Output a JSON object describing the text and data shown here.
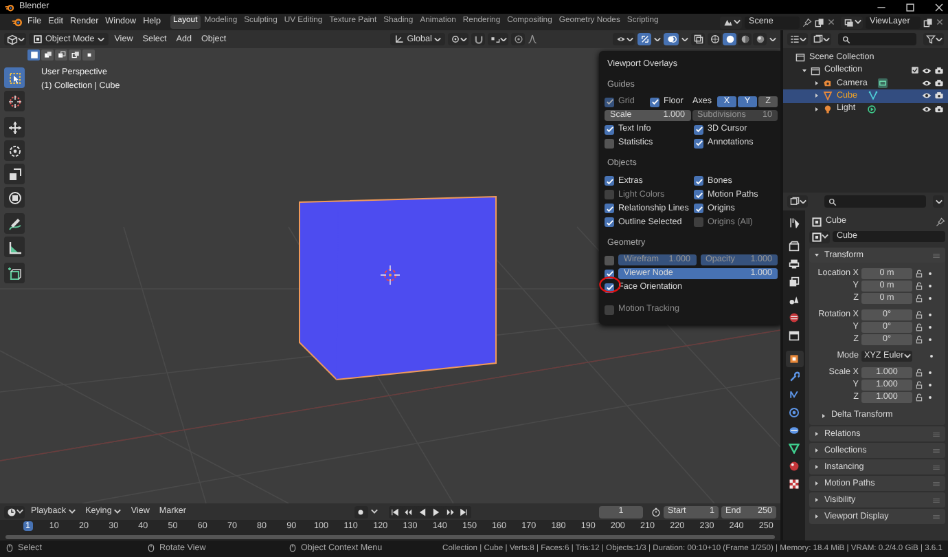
{
  "window": {
    "title": "Blender"
  },
  "menu": [
    "File",
    "Edit",
    "Render",
    "Window",
    "Help"
  ],
  "workspaces": [
    {
      "label": "Layout",
      "selected": true
    },
    {
      "label": "Modeling",
      "selected": false
    },
    {
      "label": "Sculpting",
      "selected": false
    },
    {
      "label": "UV Editing",
      "selected": false
    },
    {
      "label": "Texture Paint",
      "selected": false
    },
    {
      "label": "Shading",
      "selected": false
    },
    {
      "label": "Animation",
      "selected": false
    },
    {
      "label": "Rendering",
      "selected": false
    },
    {
      "label": "Compositing",
      "selected": false
    },
    {
      "label": "Geometry Nodes",
      "selected": false
    },
    {
      "label": "Scripting",
      "selected": false
    }
  ],
  "scene": "Scene",
  "view_layer": "ViewLayer",
  "viewport_header": {
    "mode": "Object Mode",
    "menus": [
      "View",
      "Select",
      "Add",
      "Object"
    ],
    "orientation": "Global",
    "gizmos": true,
    "overlays": true,
    "xray": false,
    "shading": [
      {
        "kind": "wireframe",
        "selected": false
      },
      {
        "kind": "solid",
        "selected": true
      },
      {
        "kind": "material",
        "selected": false
      },
      {
        "kind": "rendered",
        "selected": false
      }
    ]
  },
  "viewport": {
    "view_name": "User Perspective",
    "collection_info": "(1) Collection | Cube",
    "select_modes": [
      {
        "kind": "new",
        "selected": true
      },
      {
        "kind": "extend",
        "selected": false
      },
      {
        "kind": "subtract",
        "selected": false
      },
      {
        "kind": "invert",
        "selected": false
      },
      {
        "kind": "intersect",
        "selected": false
      }
    ],
    "tool_groups": [
      {
        "tools": [
          {
            "kind": "select_box",
            "selected": true
          },
          {
            "kind": "cursor",
            "selected": false
          }
        ]
      },
      {
        "tools": [
          {
            "kind": "move",
            "selected": false
          },
          {
            "kind": "rotate",
            "selected": false
          },
          {
            "kind": "scale",
            "selected": false
          },
          {
            "kind": "transform",
            "selected": false
          }
        ]
      },
      {
        "tools": [
          {
            "kind": "annotate",
            "selected": false
          },
          {
            "kind": "measure",
            "selected": false
          }
        ]
      },
      {
        "tools": [
          {
            "kind": "add_cube",
            "selected": false
          }
        ]
      }
    ]
  },
  "overlays": {
    "title": "Viewport Overlays",
    "sections": [
      {
        "title": "Guides",
        "rows": [
          {
            "kind": "grid",
            "cells": [
              {
                "label": "Grid",
                "checked": true,
                "disabled": true,
                "circled": false
              },
              {
                "label": "Floor",
                "checked": true,
                "disabled": false,
                "circled": false
              }
            ],
            "axes_label": "Axes",
            "axes": [
              {
                "label": "X",
                "selected": true
              },
              {
                "label": "Y",
                "selected": true
              },
              {
                "label": "Z",
                "selected": false
              }
            ]
          },
          {
            "kind": "fields",
            "fields": [
              {
                "label": "Scale",
                "value": "1.000",
                "disabled": false
              },
              {
                "label": "Subdivisions",
                "value": "10",
                "disabled": true
              }
            ]
          },
          {
            "kind": "checks",
            "cells": [
              {
                "label": "Text Info",
                "checked": true,
                "disabled": false,
                "circled": false
              },
              {
                "label": "3D Cursor",
                "checked": true,
                "disabled": false,
                "circled": false
              }
            ]
          },
          {
            "kind": "checks",
            "cells": [
              {
                "label": "Statistics",
                "checked": false,
                "disabled": false,
                "circled": false
              },
              {
                "label": "Annotations",
                "checked": true,
                "disabled": false,
                "circled": false
              }
            ]
          }
        ]
      },
      {
        "title": "Objects",
        "rows": [
          {
            "kind": "checks",
            "cells": [
              {
                "label": "Extras",
                "checked": true,
                "disabled": false,
                "circled": false
              },
              {
                "label": "Bones",
                "checked": true,
                "disabled": false,
                "circled": false
              }
            ]
          },
          {
            "kind": "checks",
            "cells": [
              {
                "label": "Light Colors",
                "checked": false,
                "disabled": true,
                "circled": false
              },
              {
                "label": "Motion Paths",
                "checked": true,
                "disabled": false,
                "circled": false
              }
            ]
          },
          {
            "kind": "checks",
            "cells": [
              {
                "label": "Relationship Lines",
                "checked": true,
                "disabled": false,
                "circled": false
              },
              {
                "label": "Origins",
                "checked": true,
                "disabled": false,
                "circled": false
              }
            ]
          },
          {
            "kind": "checks",
            "cells": [
              {
                "label": "Outline Selected",
                "checked": true,
                "disabled": false,
                "circled": false
              },
              {
                "label": "Origins (All)",
                "checked": false,
                "disabled": true,
                "circled": false
              }
            ]
          }
        ]
      },
      {
        "title": "Geometry",
        "rows": [
          {
            "kind": "check_fields",
            "check": {
              "checked": false,
              "disabled": false,
              "circled": false
            },
            "fields": [
              {
                "label": "Wirefram",
                "value": "1.000",
                "level": 1,
                "disabled": true
              },
              {
                "label": "Opacity",
                "value": "1.000",
                "level": 1,
                "disabled": true
              }
            ]
          },
          {
            "kind": "check_fields",
            "check": {
              "checked": true,
              "disabled": false,
              "circled": false
            },
            "fields": [
              {
                "label": "Viewer Node",
                "value": "1.000",
                "level": 1,
                "disabled": false
              }
            ]
          },
          {
            "kind": "checks",
            "cells": [
              {
                "label": "Face Orientation",
                "checked": true,
                "disabled": false,
                "circled": true
              }
            ]
          }
        ]
      },
      {
        "rows": [
          {
            "kind": "checks",
            "cells": [
              {
                "label": "Motion Tracking",
                "checked": false,
                "disabled": true,
                "circled": false
              }
            ]
          }
        ]
      }
    ]
  },
  "outliner": {
    "root": "Scene Collection",
    "items": [
      {
        "label": "Collection",
        "kind": "collection",
        "expanded": true,
        "selected": false,
        "included": true,
        "visible": true,
        "renderable": true,
        "children": [
          {
            "label": "Camera",
            "kind": "camera",
            "expanded": false,
            "selected": false,
            "visible": true,
            "renderable": true
          },
          {
            "label": "Cube",
            "kind": "mesh",
            "expanded": false,
            "selected": true,
            "visible": true,
            "renderable": true
          },
          {
            "label": "Light",
            "kind": "light",
            "expanded": false,
            "selected": false,
            "visible": true,
            "renderable": true
          }
        ]
      }
    ]
  },
  "properties": {
    "tab_groups": [
      {
        "tabs": [
          {
            "kind": "tool",
            "selected": false
          }
        ]
      },
      {
        "tabs": [
          {
            "kind": "render",
            "selected": false
          },
          {
            "kind": "output",
            "selected": false
          },
          {
            "kind": "view_layer",
            "selected": false
          },
          {
            "kind": "scene",
            "selected": false
          },
          {
            "kind": "world",
            "selected": false
          },
          {
            "kind": "collection",
            "selected": false
          }
        ]
      },
      {
        "tabs": [
          {
            "kind": "object",
            "selected": true
          },
          {
            "kind": "modifiers",
            "selected": false
          },
          {
            "kind": "particles",
            "selected": false
          },
          {
            "kind": "physics",
            "selected": false
          },
          {
            "kind": "constraints",
            "selected": false
          },
          {
            "kind": "data",
            "selected": false
          },
          {
            "kind": "material",
            "selected": false
          },
          {
            "kind": "texture",
            "selected": false
          }
        ]
      }
    ],
    "object_name": "Cube",
    "data_name": "Cube",
    "panels": [
      {
        "title": "Transform",
        "expanded": true,
        "groups": [
          {
            "rows": [
              {
                "kind": "field",
                "label": "Location X",
                "value": "0 m"
              },
              {
                "kind": "field",
                "label": "Y",
                "value": "0 m"
              },
              {
                "kind": "field",
                "label": "Z",
                "value": "0 m"
              }
            ]
          },
          {
            "rows": [
              {
                "kind": "field",
                "label": "Rotation X",
                "value": "0°"
              },
              {
                "kind": "field",
                "label": "Y",
                "value": "0°"
              },
              {
                "kind": "field",
                "label": "Z",
                "value": "0°"
              }
            ]
          },
          {
            "rows": [
              {
                "kind": "dropdown",
                "label": "Mode",
                "value": "XYZ Euler"
              }
            ]
          },
          {
            "rows": [
              {
                "kind": "field",
                "label": "Scale X",
                "value": "1.000"
              },
              {
                "kind": "field",
                "label": "Y",
                "value": "1.000"
              },
              {
                "kind": "field",
                "label": "Z",
                "value": "1.000"
              }
            ]
          }
        ],
        "subpanels": [
          {
            "title": "Delta Transform",
            "expanded": false
          }
        ]
      },
      {
        "title": "Relations",
        "expanded": false
      },
      {
        "title": "Collections",
        "expanded": false
      },
      {
        "title": "Instancing",
        "expanded": false
      },
      {
        "title": "Motion Paths",
        "expanded": false
      },
      {
        "title": "Visibility",
        "expanded": false
      },
      {
        "title": "Viewport Display",
        "expanded": false
      }
    ]
  },
  "timeline": {
    "menus": [
      "Playback",
      "Keying",
      "View",
      "Marker"
    ],
    "current_frame": "1",
    "start_label": "Start",
    "start": "1",
    "end_label": "End",
    "end": "250",
    "ruler": [
      {
        "label": "1",
        "selected": true
      },
      {
        "label": "10",
        "selected": false
      },
      {
        "label": "20",
        "selected": false
      },
      {
        "label": "30",
        "selected": false
      },
      {
        "label": "40",
        "selected": false
      },
      {
        "label": "50",
        "selected": false
      },
      {
        "label": "60",
        "selected": false
      },
      {
        "label": "70",
        "selected": false
      },
      {
        "label": "80",
        "selected": false
      },
      {
        "label": "90",
        "selected": false
      },
      {
        "label": "100",
        "selected": false
      },
      {
        "label": "110",
        "selected": false
      },
      {
        "label": "120",
        "selected": false
      },
      {
        "label": "130",
        "selected": false
      },
      {
        "label": "140",
        "selected": false
      },
      {
        "label": "150",
        "selected": false
      },
      {
        "label": "160",
        "selected": false
      },
      {
        "label": "170",
        "selected": false
      },
      {
        "label": "180",
        "selected": false
      },
      {
        "label": "190",
        "selected": false
      },
      {
        "label": "200",
        "selected": false
      },
      {
        "label": "210",
        "selected": false
      },
      {
        "label": "220",
        "selected": false
      },
      {
        "label": "230",
        "selected": false
      },
      {
        "label": "240",
        "selected": false
      },
      {
        "label": "250",
        "selected": false
      }
    ]
  },
  "status_bar": {
    "hints": [
      "Select",
      "Rotate View",
      "Object Context Menu"
    ],
    "info": "Collection | Cube | Verts:8 | Faces:6 | Tris:12 | Objects:1/3 | Duration: 00:10+10 (Frame 1/250) | Memory: 18.4 MiB | VRAM: 0.2/4.0 GiB | 3.6.1"
  }
}
